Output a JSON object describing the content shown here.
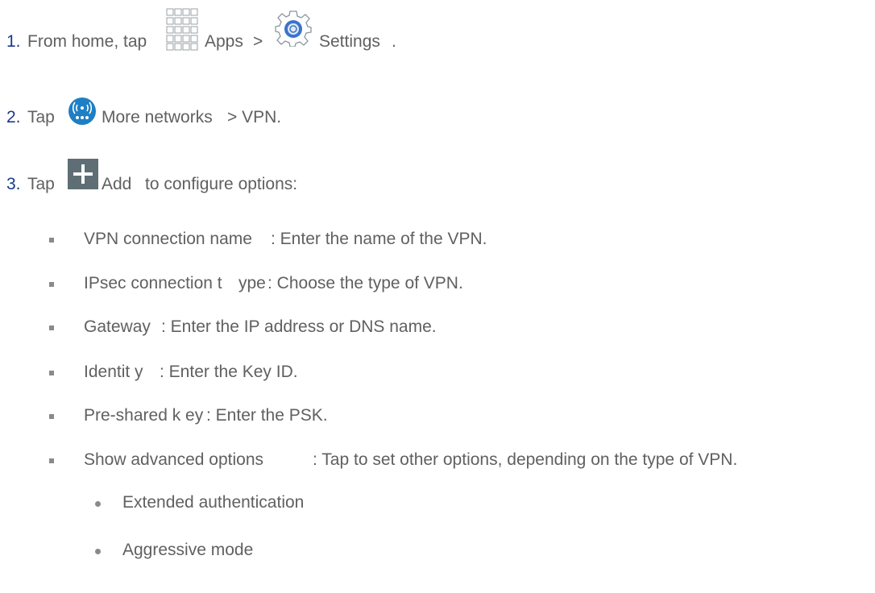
{
  "steps": [
    {
      "number": "1.",
      "parts": [
        "From home, tap",
        "Apps",
        ">",
        "Settings",
        "."
      ]
    },
    {
      "number": "2.",
      "parts": [
        "Tap",
        "More networks",
        "> VPN."
      ]
    },
    {
      "number": "3.",
      "parts": [
        "Tap",
        "Add",
        "to configure options:"
      ]
    }
  ],
  "options": [
    {
      "label": "VPN connection name",
      "desc": ": Enter the name of the VPN."
    },
    {
      "label": "IPsec connection t",
      "label2": "ype",
      "desc": ": Choose the type of VPN."
    },
    {
      "label": "Gateway",
      "desc": ": Enter the IP address or DNS name."
    },
    {
      "label": "Identit y",
      "desc": ": Enter the Key ID."
    },
    {
      "label": "Pre-shared k ey",
      "desc": ": Enter the PSK."
    },
    {
      "label": "Show advanced options",
      "desc": ": Tap to set other options, depending on the type of VPN."
    }
  ],
  "sub_options": [
    "Extended authentication",
    "Aggressive mode"
  ],
  "icons": {
    "apps": "apps-grid-icon",
    "settings": "settings-gear-icon",
    "more_networks": "more-networks-icon",
    "add": "add-plus-icon"
  },
  "colors": {
    "step_number": "#1a3a8a",
    "text": "#606060",
    "network_icon_blue": "#1e7fc4",
    "add_icon_gray": "#5e6e74"
  }
}
